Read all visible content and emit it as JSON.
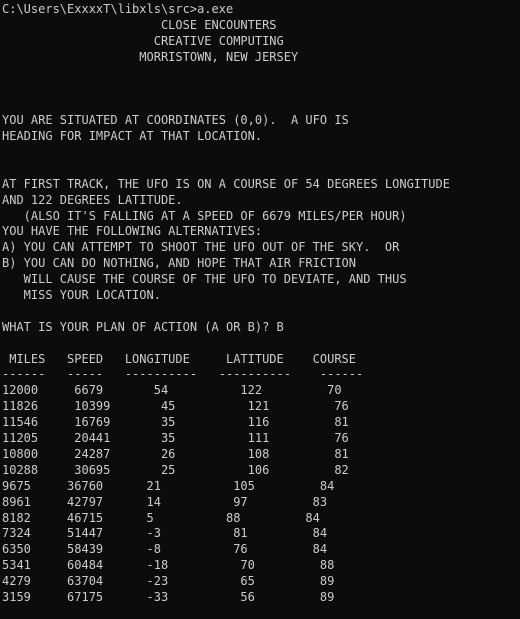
{
  "console": {
    "lines": [
      "C:\\Users\\ExxxxT\\libxls\\src>a.exe",
      "                      CLOSE ENCOUNTERS",
      "                     CREATIVE COMPUTING",
      "                   MORRISTOWN, NEW JERSEY",
      "",
      "",
      "",
      "YOU ARE SITUATED AT COORDINATES (0,0).  A UFO IS",
      "HEADING FOR IMPACT AT THAT LOCATION.",
      "",
      "",
      "AT FIRST TRACK, THE UFO IS ON A COURSE OF 54 DEGREES LONGITUDE",
      "AND 122 DEGREES LATITUDE.",
      "   (ALSO IT'S FALLING AT A SPEED OF 6679 MILES/PER HOUR)",
      "YOU HAVE THE FOLLOWING ALTERNATIVES:",
      "A) YOU CAN ATTEMPT TO SHOOT THE UFO OUT OF THE SKY.  OR",
      "B) YOU CAN DO NOTHING, AND HOPE THAT AIR FRICTION",
      "   WILL CAUSE THE COURSE OF THE UFO TO DEVIATE, AND THUS",
      "   MISS YOUR LOCATION.",
      "",
      "WHAT IS YOUR PLAN OF ACTION (A OR B)? B",
      "",
      " MILES   SPEED   LONGITUDE     LATITUDE    COURSE",
      "------   -----   ----------   ----------    ------",
      "12000     6679       54          122         70",
      "11826     10399       45          121         76",
      "11546     16769       35          116         81",
      "11205     20441       35          111         76",
      "10800     24287       26          108         81",
      "10288     30695       25          106         82",
      "9675     36760      21          105         84",
      "8961     42797      14          97         83",
      "8182     46715      5          88         84",
      "7324     51447      -3          81         84",
      "6350     58439      -8          76         84",
      "5341     60484      -18          70         88",
      "4279     63704      -23          65         89",
      "3159     67175      -33          56         89"
    ]
  }
}
